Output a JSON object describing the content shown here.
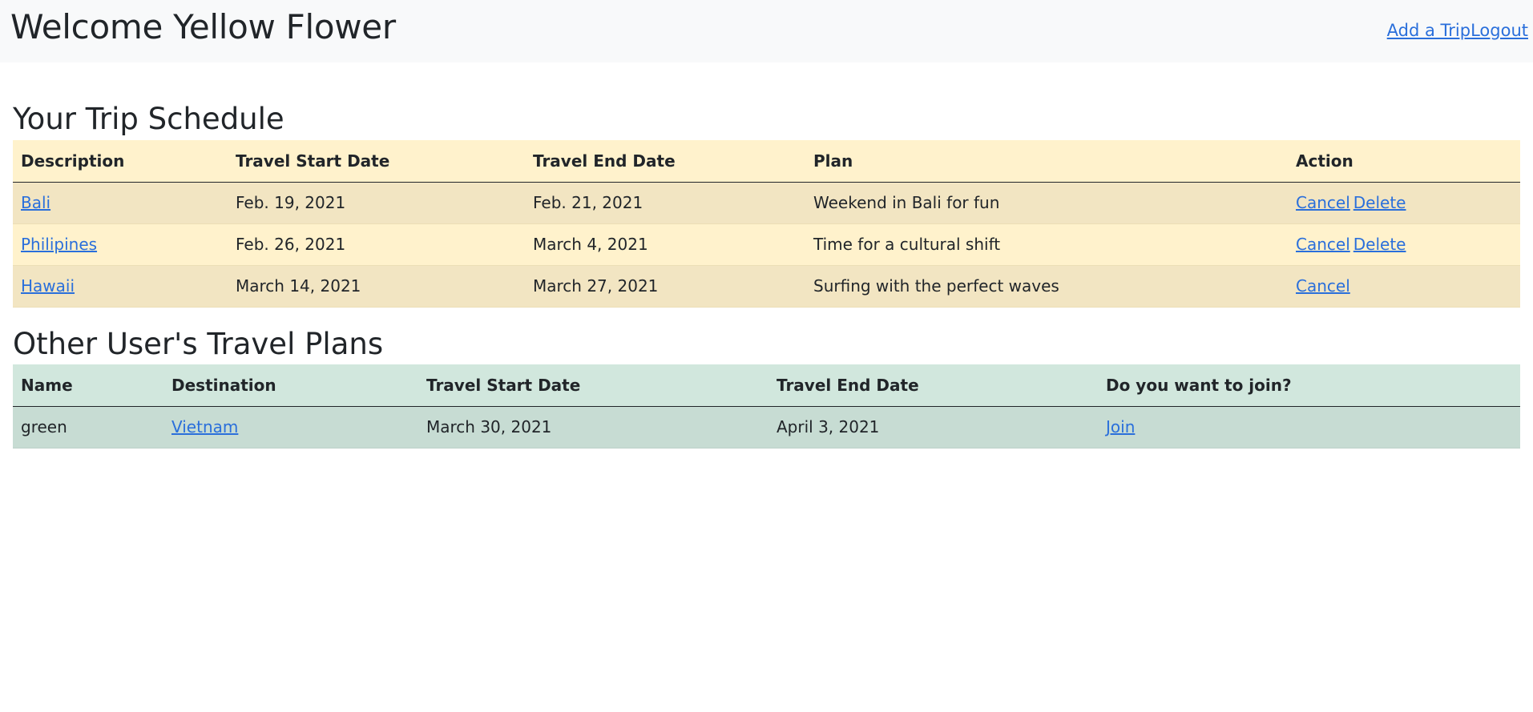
{
  "header": {
    "title": "Welcome Yellow Flower",
    "add_trip_label": "Add a Trip",
    "logout_label": "Logout"
  },
  "trips": {
    "heading": "Your Trip Schedule",
    "columns": [
      "Description",
      "Travel Start Date",
      "Travel End Date",
      "Plan",
      "Action"
    ],
    "rows": [
      {
        "description": "Bali",
        "start": "Feb. 19, 2021",
        "end": "Feb. 21, 2021",
        "plan": "Weekend in Bali for fun",
        "cancel": "Cancel",
        "delete": "Delete"
      },
      {
        "description": "Philipines",
        "start": "Feb. 26, 2021",
        "end": "March 4, 2021",
        "plan": "Time for a cultural shift",
        "cancel": "Cancel",
        "delete": "Delete"
      },
      {
        "description": "Hawaii",
        "start": "March 14, 2021",
        "end": "March 27, 2021",
        "plan": "Surfing with the perfect waves",
        "cancel": "Cancel",
        "delete": null
      }
    ]
  },
  "others": {
    "heading": "Other User's Travel Plans",
    "columns": [
      "Name",
      "Destination",
      "Travel Start Date",
      "Travel End Date",
      "Do you want to join?"
    ],
    "rows": [
      {
        "name": "green",
        "destination": "Vietnam",
        "start": "March 30, 2021",
        "end": "April 3, 2021",
        "join": "Join"
      }
    ]
  },
  "colors": {
    "link": "#2a6fdb",
    "navbar_bg": "#f8f9fa",
    "trips_header_bg": "#fff2cc",
    "trips_row_alt_bg": "#f2e5c2",
    "others_header_bg": "#d1e7dd",
    "others_row_bg": "#c7dcd3"
  }
}
